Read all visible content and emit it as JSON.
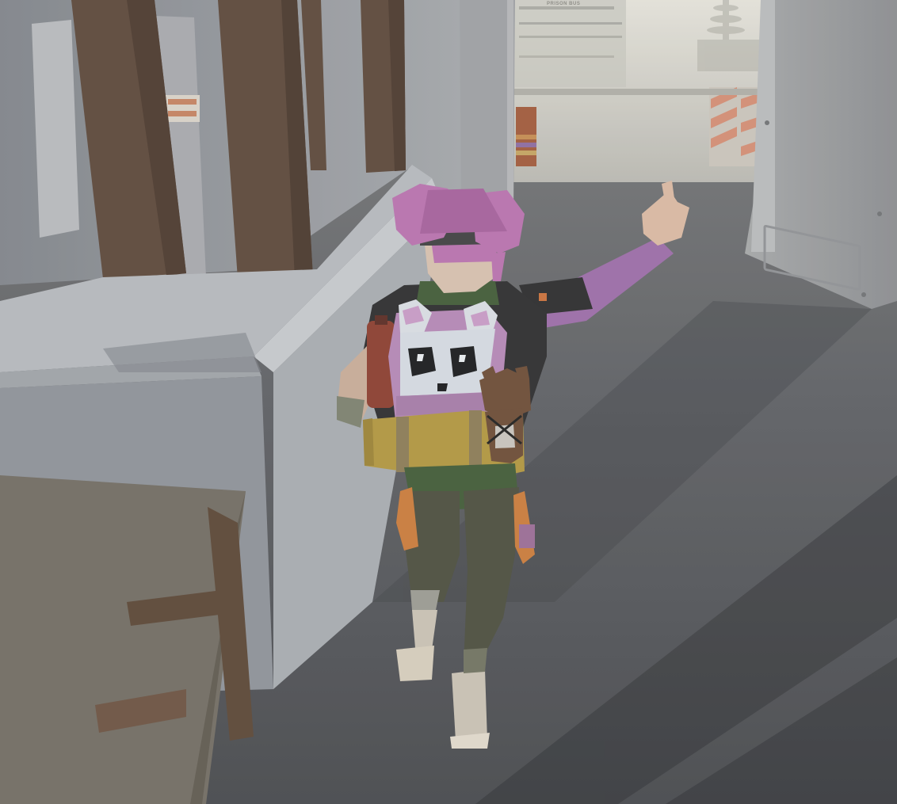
{
  "scene": {
    "distant_sign": "PRISON BUS",
    "palette": {
      "floor": "#505258",
      "wall": "#8d9096",
      "pillar": "#5e4a3c",
      "fog": "#d9d7cf",
      "hair": "#b870ae",
      "backpack": "#b486b6",
      "bedroll": "#b0953e",
      "jacket": "#2b2b2d",
      "pants": "#4a4c3d"
    }
  }
}
